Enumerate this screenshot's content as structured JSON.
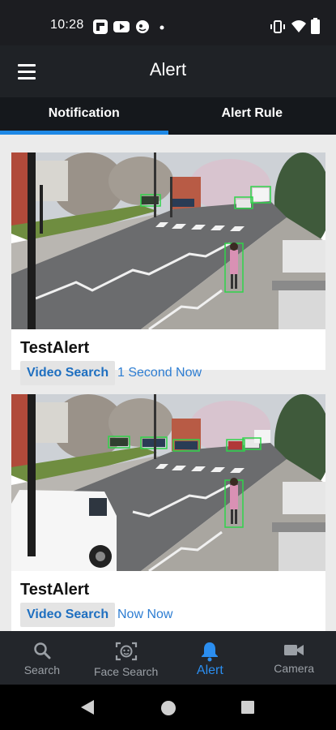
{
  "status_bar": {
    "time": "10:28",
    "left_icons": [
      "flipboard-icon",
      "youtube-icon",
      "app-icon",
      "dot-icon"
    ],
    "right_icons": [
      "vibrate-icon",
      "wifi-icon",
      "battery-icon"
    ]
  },
  "app_bar": {
    "title": "Alert",
    "menu_icon": "hamburger-menu-icon"
  },
  "tabs": [
    {
      "label": "Notification",
      "active": true
    },
    {
      "label": "Alert Rule",
      "active": false
    }
  ],
  "alerts": [
    {
      "title": "TestAlert",
      "action_label": "Video Search",
      "time_text": "1 Second Now"
    },
    {
      "title": "TestAlert",
      "action_label": "Video Search",
      "time_text": "Now Now"
    }
  ],
  "bottom_nav": [
    {
      "label": "Search",
      "icon": "search-icon",
      "active": false
    },
    {
      "label": "Face Search",
      "icon": "face-scan-icon",
      "active": false
    },
    {
      "label": "Alert",
      "icon": "bell-icon",
      "active": true
    },
    {
      "label": "Camera",
      "icon": "video-camera-icon",
      "active": false
    }
  ],
  "system_nav": [
    "back-icon",
    "home-icon",
    "recents-icon"
  ],
  "colors": {
    "accent": "#1e88e5",
    "app_bar": "#1f2226",
    "tab_bar": "#15181c",
    "bottom_nav": "#23262b",
    "link": "#2d7dd2"
  }
}
